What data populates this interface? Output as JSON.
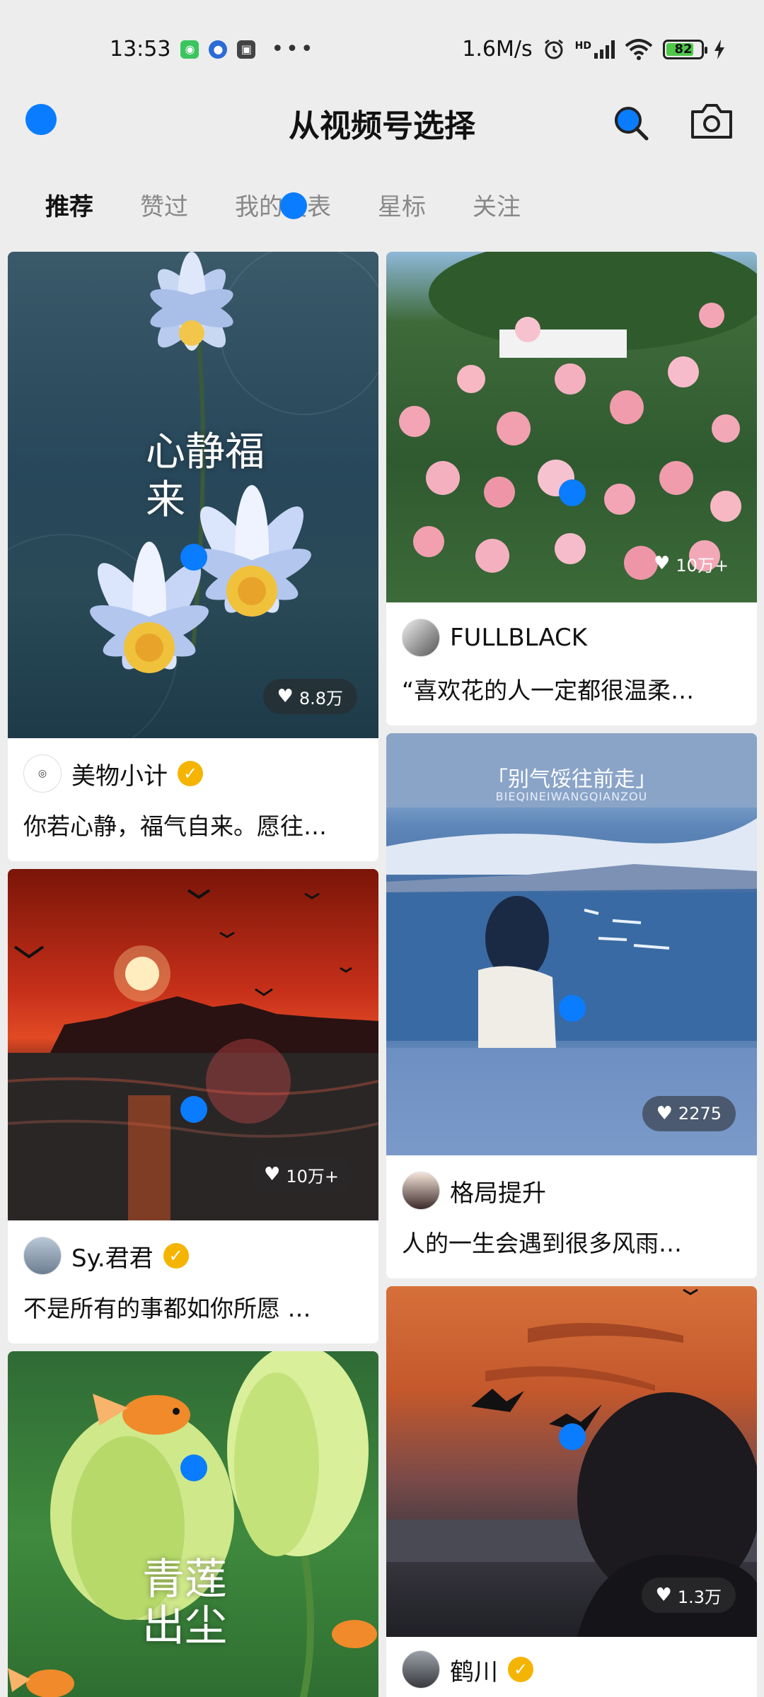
{
  "status_bar": {
    "time": "13:53",
    "net_speed": "1.6M/s",
    "battery": "82",
    "network_label": "HD"
  },
  "header": {
    "title": "从视频号选择"
  },
  "tabs": [
    {
      "label": "推荐",
      "active": true
    },
    {
      "label": "赞过",
      "active": false
    },
    {
      "label": "我的发表",
      "active": false
    },
    {
      "label": "星标",
      "active": false
    },
    {
      "label": "关注",
      "active": false
    }
  ],
  "cards_left": [
    {
      "likes": "8.8万",
      "author": "美物小计",
      "verified": true,
      "desc": "你若心静，福气自来。愿往…",
      "overlay_text": "心静福来"
    },
    {
      "likes": "10万+",
      "author": "Sy.君君",
      "verified": true,
      "desc": "不是所有的事都如你所愿 …"
    },
    {
      "overlay_text": "青莲出尘"
    }
  ],
  "cards_right": [
    {
      "likes": "10万+",
      "author": "FULLBLACK",
      "verified": false,
      "desc": "“喜欢花的人一定都很温柔…"
    },
    {
      "likes": "2275",
      "author": "格局提升",
      "verified": false,
      "desc": "人的一生会遇到很多风雨…",
      "overlay_title": "「别气馁往前走」",
      "overlay_sub": "BIEQINEIWANGQIANZOU"
    },
    {
      "likes": "1.3万",
      "author": "鹤川",
      "verified": true
    }
  ],
  "colors": {
    "accent": "#0a7cff",
    "verified": "#f4b400",
    "background": "#ededed"
  }
}
